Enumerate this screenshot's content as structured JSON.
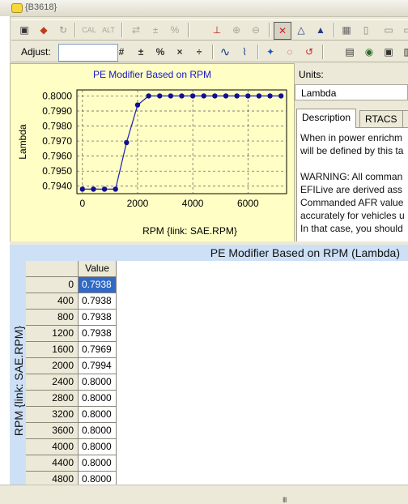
{
  "window": {
    "title": "{B3618}"
  },
  "toolbar1": {
    "cal_label": "CAL",
    "alt_label": "ALT"
  },
  "toolbar2": {
    "adjust_label": "Adjust:",
    "adjust_value": ""
  },
  "chart_data": {
    "type": "line",
    "title": "PE Modifier Based on RPM",
    "xlabel": "RPM {link: SAE.RPM}",
    "ylabel": "Lambda",
    "x": [
      0,
      400,
      800,
      1200,
      1600,
      2000,
      2400,
      2800,
      3200,
      3600,
      4000,
      4400,
      4800,
      5200,
      5600,
      6000,
      6400,
      6800,
      7200
    ],
    "series": [
      {
        "values": [
          0.7938,
          0.7938,
          0.7938,
          0.7938,
          0.7969,
          0.7994,
          0.8,
          0.8,
          0.8,
          0.8,
          0.8,
          0.8,
          0.8,
          0.8,
          0.8,
          0.8,
          0.8,
          0.8,
          0.8
        ]
      }
    ],
    "x_ticks": [
      "0",
      "2000",
      "4000",
      "6000"
    ],
    "y_ticks": [
      "0.7940",
      "0.7950",
      "0.7960",
      "0.7970",
      "0.7980",
      "0.7990",
      "0.8000"
    ],
    "xlim": [
      -200,
      7400
    ],
    "ylim": [
      0.7935,
      0.8004
    ],
    "grid": true,
    "line_color": "#1c1cb8",
    "marker_color": "#101090",
    "background": "#ffffc5"
  },
  "units": {
    "label": "Units:",
    "value": "Lambda"
  },
  "tabs": [
    {
      "label": "Description"
    },
    {
      "label": "RTACS"
    }
  ],
  "description_lines": [
    "When in power enrichm",
    "will be defined by this ta",
    "",
    "WARNING: All comman",
    "EFILive are derived ass",
    "Commanded AFR value",
    "accurately for vehicles u",
    "In that case, you should"
  ],
  "table": {
    "title": "PE Modifier Based on RPM (Lambda)",
    "axis_label": "RPM {link: SAE.RPM}",
    "column_header": "Value",
    "rows": [
      {
        "rpm": "0",
        "value": "0.7938"
      },
      {
        "rpm": "400",
        "value": "0.7938"
      },
      {
        "rpm": "800",
        "value": "0.7938"
      },
      {
        "rpm": "1200",
        "value": "0.7938"
      },
      {
        "rpm": "1600",
        "value": "0.7969"
      },
      {
        "rpm": "2000",
        "value": "0.7994"
      },
      {
        "rpm": "2400",
        "value": "0.8000"
      },
      {
        "rpm": "2800",
        "value": "0.8000"
      },
      {
        "rpm": "3200",
        "value": "0.8000"
      },
      {
        "rpm": "3600",
        "value": "0.8000"
      },
      {
        "rpm": "4000",
        "value": "0.8000"
      },
      {
        "rpm": "4400",
        "value": "0.8000"
      },
      {
        "rpm": "4800",
        "value": "0.8000"
      }
    ]
  },
  "statusbar": {
    "grip": "III"
  }
}
